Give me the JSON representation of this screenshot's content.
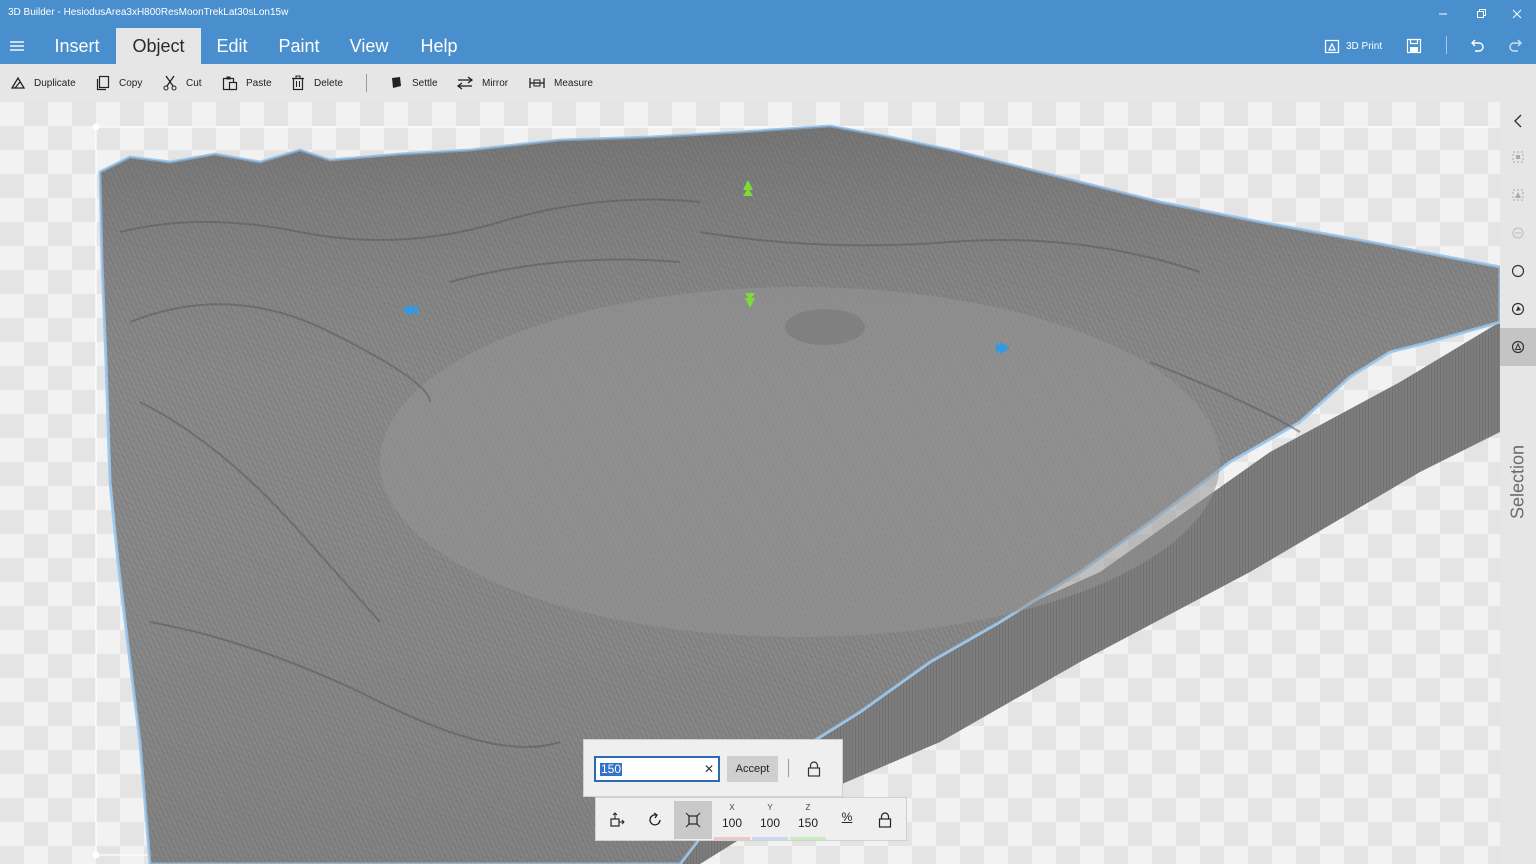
{
  "window": {
    "title": "3D Builder - HesiodusArea3xH800ResMoonTrekLat30sLon15w"
  },
  "ribbon": {
    "tabs": [
      "Insert",
      "Object",
      "Edit",
      "Paint",
      "View",
      "Help"
    ],
    "active_tab": "Object",
    "print_label": "3D Print"
  },
  "toolbar": {
    "duplicate": "Duplicate",
    "copy": "Copy",
    "cut": "Cut",
    "paste": "Paste",
    "delete": "Delete",
    "settle": "Settle",
    "mirror": "Mirror",
    "measure": "Measure"
  },
  "side_panel": {
    "label": "Selection"
  },
  "input_dialog": {
    "value": "150",
    "accept_label": "Accept"
  },
  "scale_bar": {
    "x_label": "X",
    "x_value": "100",
    "y_label": "Y",
    "y_value": "100",
    "z_label": "Z",
    "z_value": "150",
    "percent_label": "%"
  },
  "colors": {
    "accent": "#4a8fcd",
    "selection_outline": "#8fc0ee",
    "gizmo_green": "#7ddb3a",
    "gizmo_blue": "#2f9be6",
    "terrain": "#8c8c8c"
  }
}
